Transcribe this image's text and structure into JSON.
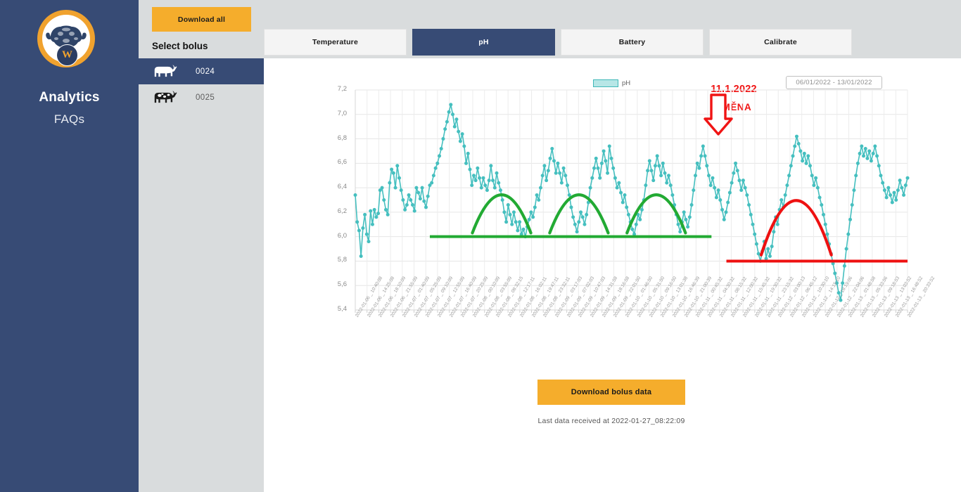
{
  "brand": {
    "logo_icon": "buffalo-head-icon",
    "logo_badge_letter": "W",
    "nav_title": "Analytics",
    "nav_link": "FAQs"
  },
  "sidebar": {
    "download_all_label": "Download all",
    "select_bolus_label": "Select bolus",
    "items": [
      {
        "id": "0024",
        "icon": "cow-icon",
        "selected": true
      },
      {
        "id": "0025",
        "icon": "cow-icon",
        "selected": false
      }
    ]
  },
  "tabs": [
    {
      "label": "Temperature",
      "active": false
    },
    {
      "label": "pH",
      "active": true
    },
    {
      "label": "Battery",
      "active": false
    },
    {
      "label": "Calibrate",
      "active": false
    }
  ],
  "controls": {
    "date_range": "06/01/2022 - 13/01/2022",
    "download_bolus_data_label": "Download bolus data",
    "last_data_text": "Last data received at 2022-01-27_08:22:09"
  },
  "annotations": [
    {
      "name": "change-date",
      "text": "11.1.2022",
      "color": "#f01414"
    },
    {
      "name": "change-word",
      "text": "ZMĚNA",
      "color": "#f01414"
    },
    {
      "name": "change-arrow",
      "icon": "down-arrow-icon",
      "color": "#f01414"
    }
  ],
  "chart_data": {
    "type": "line",
    "title": "",
    "xlabel": "",
    "ylabel": "",
    "ylim": [
      5.4,
      7.2
    ],
    "yticks": [
      "5,4",
      "5,6",
      "5,8",
      "6,0",
      "6,2",
      "6,4",
      "6,6",
      "6,8",
      "7,0",
      "7,2"
    ],
    "grid": true,
    "legend": [
      {
        "name": "pH",
        "color": "#45bfbf",
        "fill": "#b7e6e6"
      }
    ],
    "legend_position": "top-center",
    "series": [
      {
        "name": "pH",
        "color": "#45bfbf",
        "marker": "circle",
        "values": [
          6.34,
          6.12,
          6.05,
          5.84,
          6.07,
          6.18,
          6.02,
          5.96,
          6.21,
          6.1,
          6.22,
          6.16,
          6.19,
          6.38,
          6.4,
          6.3,
          6.22,
          6.18,
          6.44,
          6.55,
          6.52,
          6.4,
          6.58,
          6.48,
          6.38,
          6.3,
          6.22,
          6.26,
          6.34,
          6.3,
          6.26,
          6.21,
          6.4,
          6.36,
          6.31,
          6.4,
          6.29,
          6.24,
          6.33,
          6.42,
          6.44,
          6.5,
          6.56,
          6.6,
          6.66,
          6.72,
          6.8,
          6.88,
          6.94,
          7.02,
          7.08,
          7.0,
          6.9,
          6.96,
          6.86,
          6.78,
          6.84,
          6.74,
          6.6,
          6.68,
          6.55,
          6.42,
          6.5,
          6.46,
          6.56,
          6.48,
          6.4,
          6.48,
          6.42,
          6.38,
          6.46,
          6.58,
          6.46,
          6.4,
          6.52,
          6.44,
          6.38,
          6.3,
          6.2,
          6.12,
          6.26,
          6.18,
          6.1,
          6.2,
          6.12,
          6.05,
          6.12,
          6.02,
          6.06,
          6.0,
          6.08,
          6.14,
          6.2,
          6.16,
          6.24,
          6.34,
          6.3,
          6.4,
          6.5,
          6.58,
          6.46,
          6.54,
          6.64,
          6.72,
          6.62,
          6.52,
          6.6,
          6.52,
          6.44,
          6.56,
          6.5,
          6.42,
          6.34,
          6.24,
          6.16,
          6.1,
          6.04,
          6.12,
          6.2,
          6.16,
          6.1,
          6.18,
          6.28,
          6.4,
          6.48,
          6.56,
          6.64,
          6.56,
          6.48,
          6.6,
          6.7,
          6.62,
          6.52,
          6.74,
          6.64,
          6.56,
          6.48,
          6.4,
          6.44,
          6.36,
          6.28,
          6.34,
          6.24,
          6.18,
          6.12,
          6.06,
          6.02,
          6.1,
          6.18,
          6.14,
          6.22,
          6.3,
          6.42,
          6.54,
          6.62,
          6.54,
          6.46,
          6.58,
          6.66,
          6.58,
          6.5,
          6.6,
          6.52,
          6.44,
          6.5,
          6.42,
          6.34,
          6.26,
          6.18,
          6.1,
          6.04,
          6.12,
          6.2,
          6.14,
          6.08,
          6.16,
          6.26,
          6.38,
          6.5,
          6.6,
          6.56,
          6.66,
          6.74,
          6.66,
          6.58,
          6.5,
          6.42,
          6.48,
          6.4,
          6.32,
          6.38,
          6.3,
          6.22,
          6.14,
          6.2,
          6.28,
          6.36,
          6.44,
          6.52,
          6.6,
          6.54,
          6.46,
          6.38,
          6.46,
          6.4,
          6.34,
          6.26,
          6.18,
          6.1,
          6.02,
          5.94,
          5.86,
          5.8,
          5.88,
          5.96,
          5.82,
          5.9,
          5.84,
          5.92,
          6.04,
          6.16,
          6.1,
          6.22,
          6.3,
          6.24,
          6.34,
          6.42,
          6.5,
          6.58,
          6.66,
          6.74,
          6.82,
          6.76,
          6.7,
          6.62,
          6.68,
          6.6,
          6.66,
          6.58,
          6.5,
          6.42,
          6.48,
          6.4,
          6.32,
          6.26,
          6.18,
          6.1,
          6.02,
          5.94,
          5.86,
          5.78,
          5.7,
          5.62,
          5.54,
          5.48,
          5.62,
          5.76,
          5.9,
          6.02,
          6.14,
          6.26,
          6.38,
          6.5,
          6.6,
          6.68,
          6.74,
          6.66,
          6.72,
          6.64,
          6.7,
          6.62,
          6.68,
          6.74,
          6.66,
          6.58,
          6.5,
          6.44,
          6.38,
          6.32,
          6.4,
          6.34,
          6.28,
          6.36,
          6.3,
          6.38,
          6.46,
          6.4,
          6.34,
          6.42,
          6.48
        ]
      }
    ],
    "xticks": [
      "2022-01-06 _ 10:40:08",
      "2022-01-06 _ 14:25:08",
      "2022-01-06 _ 18:10:09",
      "2022-01-06 _ 21:55:09",
      "2022-01-07 _ 01:40:09",
      "2022-01-07 _ 05:25:09",
      "2022-01-07 _ 09:10:09",
      "2022-01-07 _ 12:55:09",
      "2022-01-07 _ 16:40:09",
      "2022-01-07 _ 20:25:09",
      "2022-01-08 _ 00:10:09",
      "2022-01-08 _ 03:55:09",
      "2022-01-08 _ 08:32:15",
      "2022-01-08 _ 12:17:11",
      "2022-01-08 _ 16:02:11",
      "2022-01-08 _ 19:47:11",
      "2022-01-08 _ 23:32:11",
      "2022-01-09 _ 03:17:03",
      "2022-01-09 _ 07:02:03",
      "2022-01-09 _ 10:47:03",
      "2022-01-09 _ 14:31:58",
      "2022-01-09 _ 18:16:58",
      "2022-01-09 _ 22:01:50",
      "2022-01-10 _ 01:46:50",
      "2022-01-10 _ 05:31:50",
      "2022-01-10 _ 09:16:50",
      "2022-01-10 _ 13:01:38",
      "2022-01-10 _ 16:46:39",
      "2022-01-10 _ 21:00:39",
      "2022-01-11 _ 00:45:32",
      "2022-01-11 _ 04:30:32",
      "2022-01-11 _ 08:15:32",
      "2022-01-11 _ 12:00:32",
      "2022-01-11 _ 15:45:32",
      "2022-01-11 _ 19:30:32",
      "2022-01-11 _ 23:15:32",
      "2022-01-12 _ 03:00:13",
      "2022-01-12 _ 06:45:12",
      "2022-01-12 _ 10:30:10",
      "2022-01-12 _ 14:15:10",
      "2022-01-12 _ 18:19:06",
      "2022-01-12 _ 22:04:06",
      "2022-01-13 _ 01:48:58",
      "2022-01-13 _ 05:33:56",
      "2022-01-13 _ 09:18:53",
      "2022-01-13 _ 13:03:52",
      "2022-01-13 _ 16:48:52",
      "2022-01-13 _ 20:33:52"
    ],
    "overlays": [
      {
        "name": "green-baseline",
        "type": "hline",
        "color": "#22aa33",
        "y": 6.0,
        "x_start": 0.135,
        "x_end": 0.645
      },
      {
        "name": "green-arc-1",
        "type": "arc",
        "color": "#22aa33",
        "peak": 6.5,
        "base": 6.03,
        "x_start": 0.212,
        "x_end": 0.318
      },
      {
        "name": "green-arc-2",
        "type": "arc",
        "color": "#22aa33",
        "peak": 6.5,
        "base": 6.03,
        "x_start": 0.352,
        "x_end": 0.458
      },
      {
        "name": "green-arc-3",
        "type": "arc",
        "color": "#22aa33",
        "peak": 6.5,
        "base": 6.03,
        "x_start": 0.492,
        "x_end": 0.598
      },
      {
        "name": "red-baseline",
        "type": "hline",
        "color": "#ee1111",
        "y": 5.8,
        "x_start": 0.672,
        "x_end": 1.0
      },
      {
        "name": "red-arc",
        "type": "arc",
        "color": "#ee1111",
        "peak": 6.52,
        "base": 5.85,
        "x_start": 0.735,
        "x_end": 0.862
      }
    ]
  }
}
